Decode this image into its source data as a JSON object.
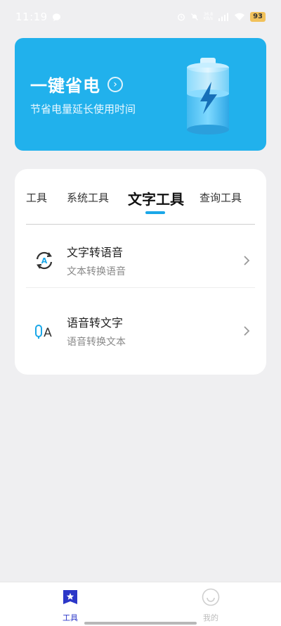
{
  "status_bar": {
    "time": "11:19",
    "net_speed_value": "36.8",
    "net_speed_unit": "KB/s",
    "battery": "93"
  },
  "banner": {
    "title": "一键省电",
    "subtitle": "节省电量延长使用时间",
    "bg_color": "#21b1ec"
  },
  "tabs": [
    {
      "label": "工具"
    },
    {
      "label": "系统工具"
    },
    {
      "label": "文字工具",
      "active": true
    },
    {
      "label": "查询工具"
    }
  ],
  "tools": [
    {
      "title": "文字转语音",
      "subtitle": "文本转换语音",
      "icon": "text-to-speech-icon"
    },
    {
      "title": "语音转文字",
      "subtitle": "语音转换文本",
      "icon": "speech-to-text-icon"
    }
  ],
  "bottom_nav": [
    {
      "label": "工具",
      "active": true,
      "icon": "star-icon",
      "color": "#2c37c8"
    },
    {
      "label": "我的",
      "active": false,
      "icon": "smile-icon",
      "color": "#bdbdbd"
    }
  ]
}
